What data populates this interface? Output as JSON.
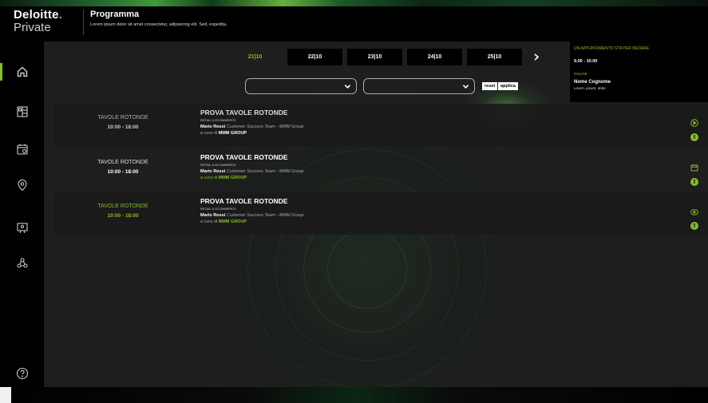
{
  "brand": {
    "name": "Deloitte",
    "dot": ".",
    "sub": "Private",
    "accent": "#86bc25"
  },
  "header": {
    "title": "Programma",
    "subtitle": "Lorem ipsum dolor sit amet consectetur, adipisicing elit. Sed, expedita."
  },
  "sidebar": {
    "items": [
      {
        "icon": "home-icon",
        "active": true
      },
      {
        "icon": "agenda-grid-icon",
        "active": false
      },
      {
        "icon": "calendar-icon",
        "active": false
      },
      {
        "icon": "location-pin-icon",
        "active": false
      },
      {
        "icon": "speaker-board-icon",
        "active": false
      },
      {
        "icon": "network-icon",
        "active": false
      }
    ],
    "help_icon": "help-icon"
  },
  "dates": {
    "tabs": [
      "21|10",
      "22|10",
      "23|10",
      "24|10",
      "25|10"
    ],
    "active_index": 0,
    "next_icon": "chevron-right-icon"
  },
  "filters": {
    "select1_value": "",
    "select2_value": "",
    "reset_label": "reset",
    "apply_label": "applica"
  },
  "notification": {
    "title": "UN APPUNTAMENTO STA PER INIZIARE",
    "time": "9.00 - 10.00",
    "mode": "ONLINE",
    "name": "Nome Cognome",
    "desc": "Lorem, ipsum, dolor."
  },
  "sessions": [
    {
      "category": "TAVOLE ROTONDE",
      "time": "10:00 - 18:00",
      "title": "PROVA TAVOLE ROTONDE",
      "tag": "RETAIL & ECOMMERCE",
      "speaker": "Mario Rossi",
      "role": "Customer Success Team - MMM Group",
      "curated_prefix": "a cura di",
      "organizer": "MMM GROUP",
      "action_icon": "play-circle-icon",
      "highlight_meta": false
    },
    {
      "category": "TAVOLE ROTONDE",
      "time": "10:00 - 18:00",
      "title": "PROVA TAVOLE ROTONDE",
      "tag": "RETAIL & ECOMMERCE",
      "speaker": "Mario Rossi",
      "role": "Customer Success Team - MMM Group",
      "curated_prefix": "a cura di",
      "organizer": "MMM GROUP",
      "action_icon": "calendar-icon",
      "highlight_meta": true
    },
    {
      "category": "TAVOLE ROTONDE",
      "time": "10:00 - 18:00",
      "title": "PROVA TAVOLE ROTONDE",
      "tag": "RETAIL & ECOMMERCE",
      "speaker": "Mario Rossi",
      "role": "Customer Success Team - MMM Group",
      "curated_prefix": "a cura di",
      "organizer": "MMM GROUP",
      "action_icon": "video-play-icon",
      "highlight_meta": false
    }
  ],
  "info_icon": "info-icon",
  "info_glyph": "!"
}
